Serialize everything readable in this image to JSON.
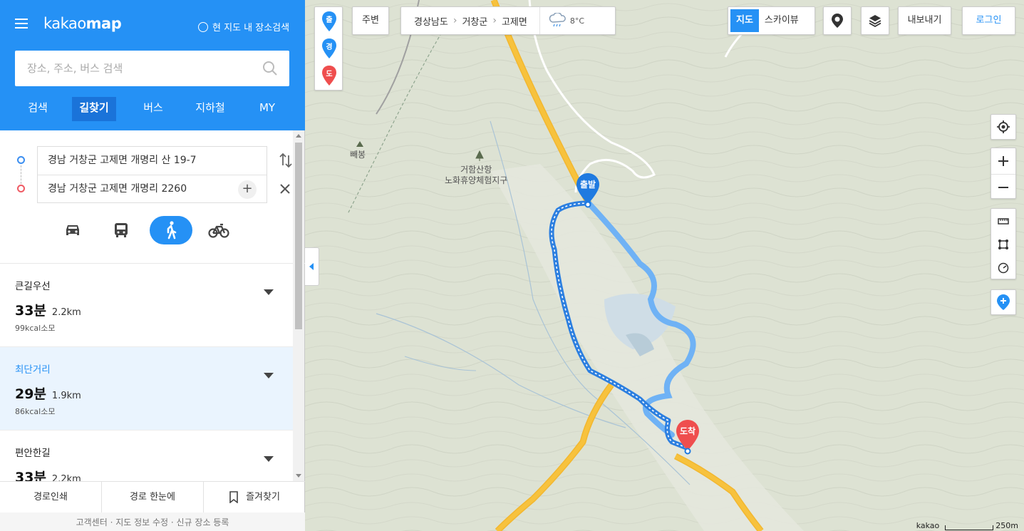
{
  "header": {
    "logo_prefix": "kakao",
    "logo_suffix": "map",
    "map_search_option": "현 지도 내 장소검색"
  },
  "search": {
    "placeholder": "장소, 주소, 버스 검색"
  },
  "tabs": [
    "검색",
    "길찾기",
    "버스",
    "지하철",
    "MY"
  ],
  "active_tab": "길찾기",
  "route": {
    "origin": "경남 거창군 고제면 개명리 산 19-7",
    "destination": "경남 거창군 고제면 개명리 2260",
    "modes": [
      "car-icon",
      "bus-icon",
      "walk-icon",
      "bike-icon"
    ],
    "active_mode": "walk-icon"
  },
  "results": [
    {
      "name": "큰길우선",
      "time": "33분",
      "distance": "2.2km",
      "kcal": "99kcal소모",
      "selected": false
    },
    {
      "name": "최단거리",
      "time": "29분",
      "distance": "1.9km",
      "kcal": "86kcal소모",
      "selected": true
    },
    {
      "name": "편안한길",
      "time": "33분",
      "distance": "2.2km",
      "kcal": "",
      "selected": false
    }
  ],
  "footer": {
    "print": "경로인쇄",
    "overview": "경로 한눈에",
    "favorite": "즐겨찾기",
    "links": "고객센터 · 지도 정보 수정 · 신규 장소 등록"
  },
  "map": {
    "nearby": "주변",
    "breadcrumb": [
      "경상남도",
      "거창군",
      "고제면"
    ],
    "temperature": "8°C",
    "map_types": [
      "지도",
      "스카이뷰"
    ],
    "active_map_type": "지도",
    "export": "내보내기",
    "login": "로그인",
    "side_pins": [
      "출",
      "경",
      "도"
    ],
    "labels": {
      "peak": "빼봉",
      "camp_line1": "거함산항",
      "camp_line2": "노화휴양체험지구"
    },
    "start_marker": "출발",
    "end_marker": "도착",
    "scale_brand": "kakao",
    "scale": "250m",
    "colors": {
      "accent": "#2591f5",
      "route": "#4aa0f2",
      "road": "#f7c23d",
      "dest": "#ef4e4e"
    }
  }
}
